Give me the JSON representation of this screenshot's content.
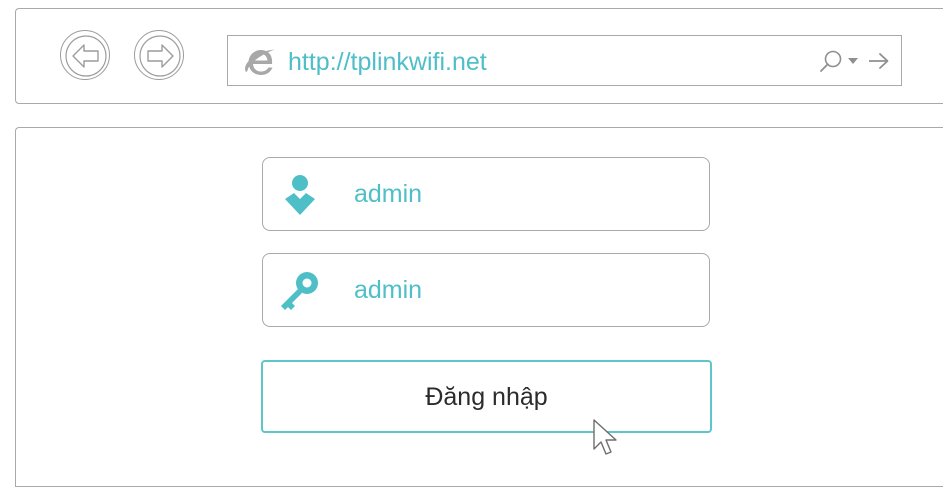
{
  "browser": {
    "url": "http://tplinkwifi.net"
  },
  "login_form": {
    "username_value": "admin",
    "password_value": "admin",
    "login_button_label": "Đăng nhập"
  },
  "colors": {
    "accent": "#4fbfc7",
    "border": "#a9a9a9",
    "button_border": "#5ec5cb",
    "text_dark": "#2b2b2b"
  },
  "icons": {
    "back": "back-arrow-icon",
    "forward": "forward-arrow-icon",
    "browser_logo": "internet-explorer-icon",
    "search": "search-icon",
    "dropdown": "dropdown-arrow-icon",
    "go": "go-arrow-icon",
    "username": "user-icon",
    "password": "key-icon",
    "pointer": "mouse-cursor-icon"
  }
}
